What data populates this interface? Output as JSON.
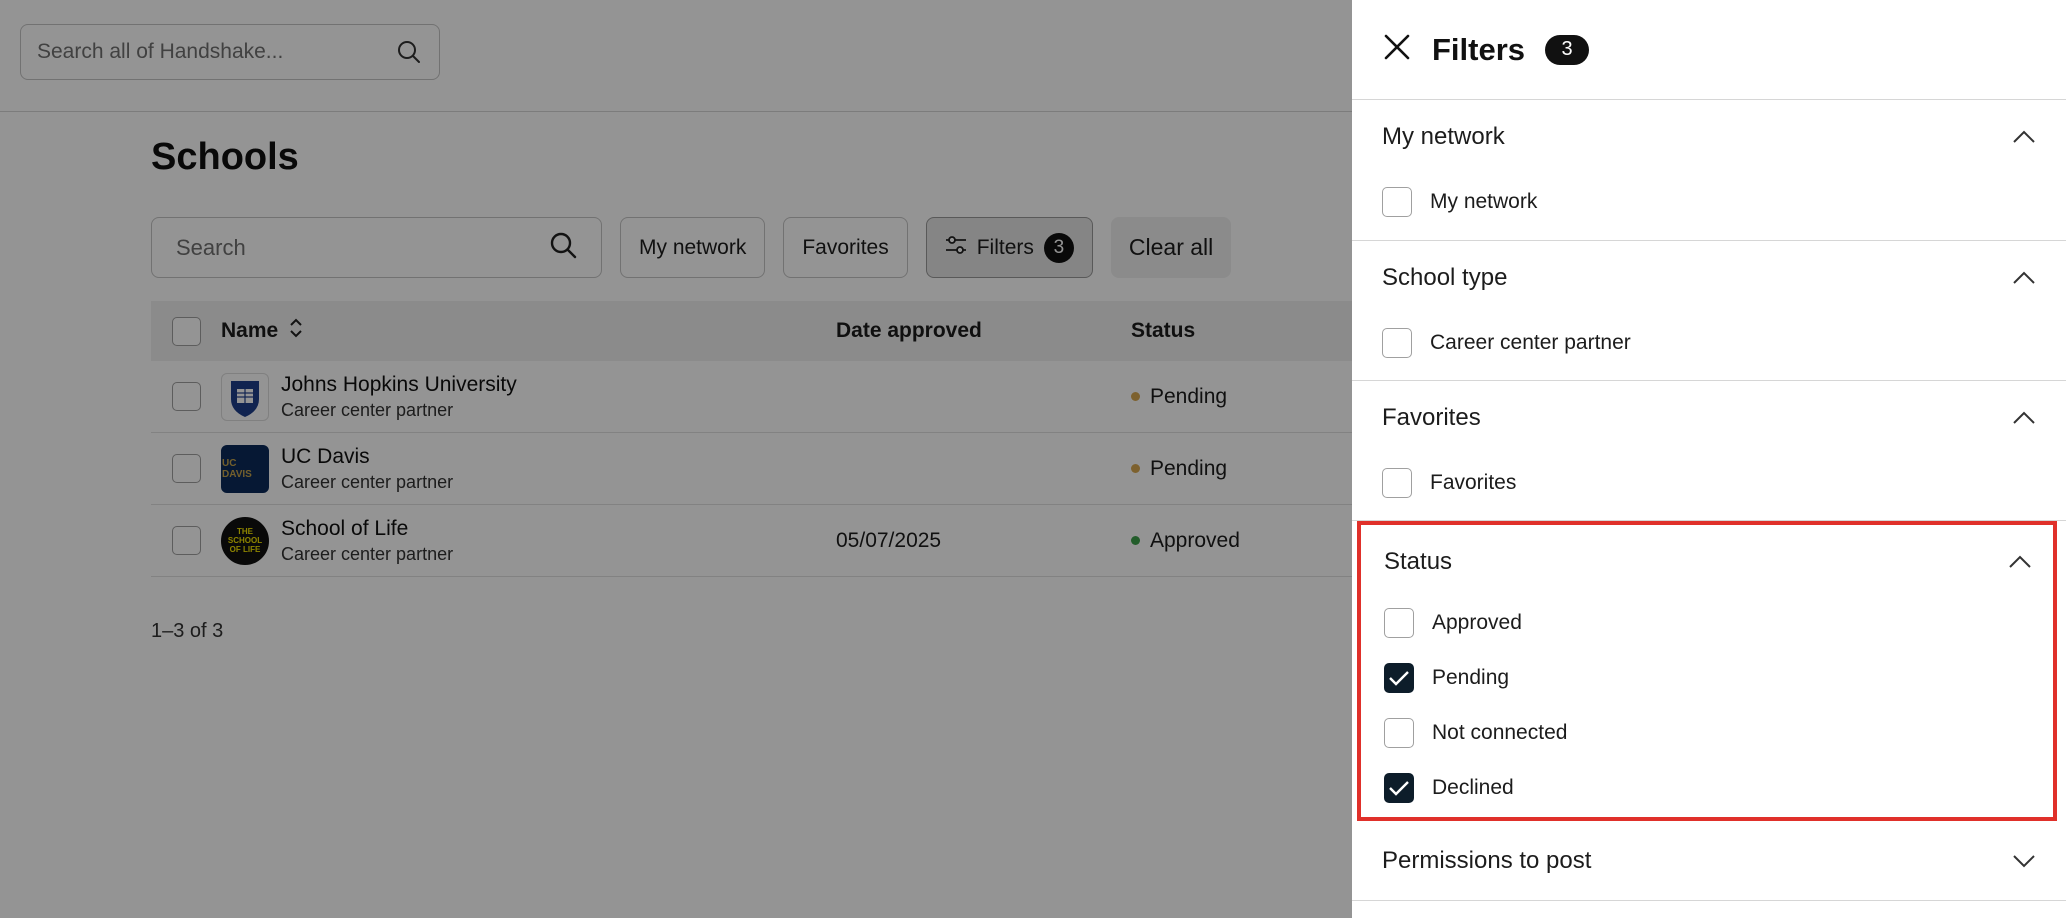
{
  "global_search": {
    "placeholder": "Search all of Handshake..."
  },
  "page": {
    "title": "Schools"
  },
  "toolbar": {
    "search_placeholder": "Search",
    "my_network_label": "My network",
    "favorites_label": "Favorites",
    "filters_label": "Filters",
    "filters_count": "3",
    "clear_all_label": "Clear all"
  },
  "table": {
    "columns": {
      "name": "Name",
      "date_approved": "Date approved",
      "status": "Status"
    },
    "rows": [
      {
        "name": "Johns Hopkins University",
        "subtitle": "Career center partner",
        "date": "",
        "status": "Pending",
        "status_color": "#d8a850",
        "logo": "JHU"
      },
      {
        "name": "UC Davis",
        "subtitle": "Career center partner",
        "date": "",
        "status": "Pending",
        "status_color": "#d8a850",
        "logo": "UC DAVIS"
      },
      {
        "name": "School of Life",
        "subtitle": "Career center partner",
        "date": "05/07/2025",
        "status": "Approved",
        "status_color": "#3da14a",
        "logo": "THE SCHOOL OF LIFE"
      }
    ]
  },
  "pager": {
    "text": "1–3 of 3"
  },
  "filters_panel": {
    "title": "Filters",
    "count": "3",
    "sections": {
      "my_network": {
        "title": "My network",
        "options": [
          "My network"
        ]
      },
      "school_type": {
        "title": "School type",
        "options": [
          "Career center partner"
        ]
      },
      "favorites": {
        "title": "Favorites",
        "options": [
          "Favorites"
        ]
      },
      "status": {
        "title": "Status",
        "options": [
          {
            "label": "Approved",
            "checked": false
          },
          {
            "label": "Pending",
            "checked": true
          },
          {
            "label": "Not connected",
            "checked": false
          },
          {
            "label": "Declined",
            "checked": true
          }
        ]
      },
      "permissions": {
        "title": "Permissions to post"
      }
    }
  },
  "colors": {
    "highlight": "#e0302a",
    "checked": "#0d1d2a",
    "pending": "#d8a850",
    "approved": "#3da14a"
  }
}
